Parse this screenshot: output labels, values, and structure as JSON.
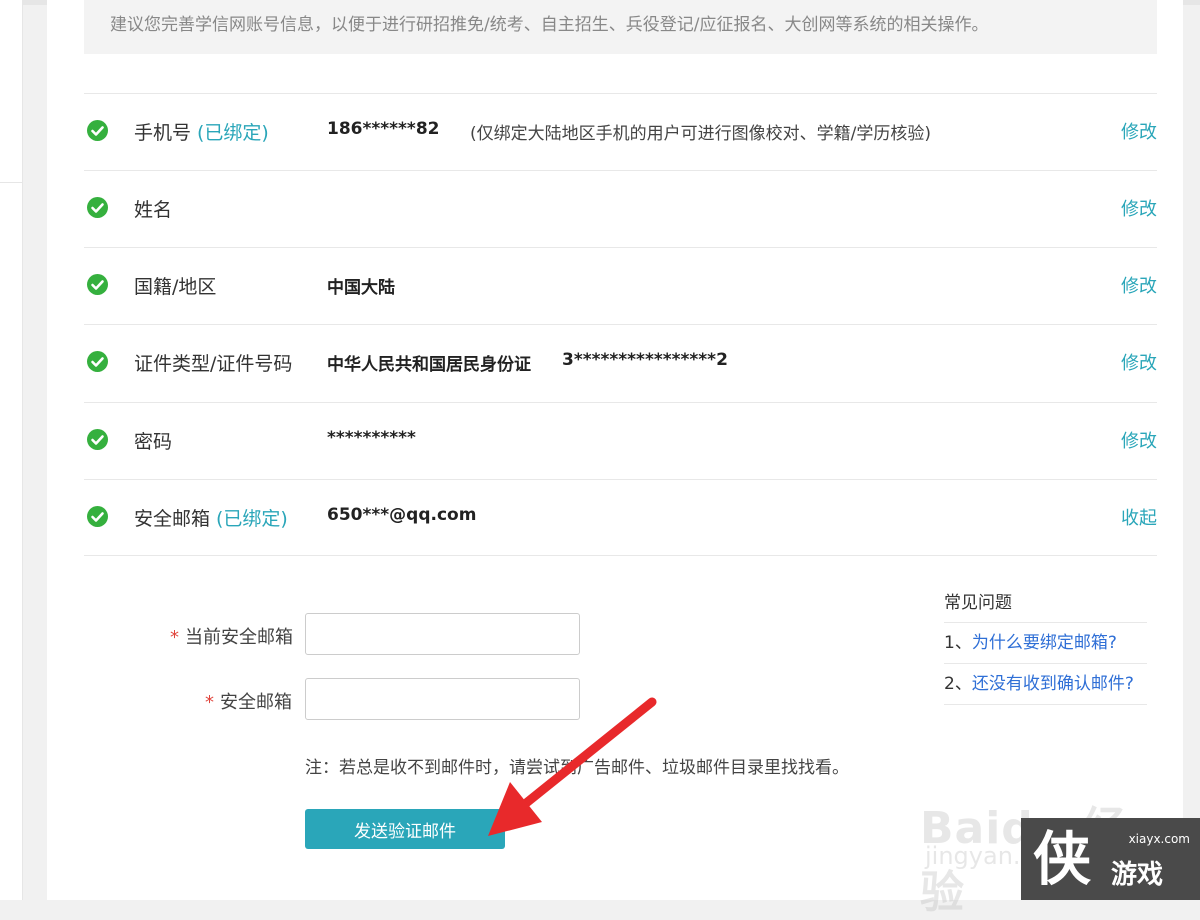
{
  "notice": {
    "text": "建议您完善学信网账号信息，以便于进行研招推免/统考、自主招生、兵役登记/应征报名、大创网等系统的相关操作。"
  },
  "rows": [
    {
      "label": "手机号",
      "tag": "(已绑定)",
      "value": "186******82",
      "note": "(仅绑定大陆地区手机的用户可进行图像校对、学籍/学历核验)",
      "action": "修改"
    },
    {
      "label": "姓名",
      "action": "修改"
    },
    {
      "label": "国籍/地区",
      "value": "中国大陆",
      "action": "修改"
    },
    {
      "label": "证件类型/证件号码",
      "value": "中华人民共和国居民身份证",
      "value2": "3****************2",
      "action": "修改"
    },
    {
      "label": "密码",
      "value": "**********",
      "action": "修改"
    },
    {
      "label": "安全邮箱",
      "tag": "(已绑定)",
      "value": "650***@qq.com",
      "action": "收起"
    }
  ],
  "form": {
    "required_mark": "*",
    "current_email_label": "当前安全邮箱",
    "new_email_label": "安全邮箱",
    "note": "注：若总是收不到邮件时，请尝试到广告邮件、垃圾邮件目录里找找看。",
    "send_button": "发送验证邮件"
  },
  "faq": {
    "title": "常见问题",
    "items": [
      {
        "num": "1、",
        "text": "为什么要绑定邮箱?"
      },
      {
        "num": "2、",
        "text": "还没有收到确认邮件?"
      }
    ]
  },
  "watermark": {
    "brand": "Baidu 经验",
    "url": "jingyan.baidu.com"
  },
  "corner_logo": {
    "site": "xiayx.com",
    "glyph": "侠",
    "text": "游戏"
  },
  "colors": {
    "accent": "#2aa6b9",
    "check": "#35b03e",
    "required": "#e0443c",
    "link": "#2f6fd6",
    "arrow": "#e8292b"
  },
  "icons": {
    "row_status": "check-circle-icon",
    "annotation": "red-arrow-pointer"
  }
}
